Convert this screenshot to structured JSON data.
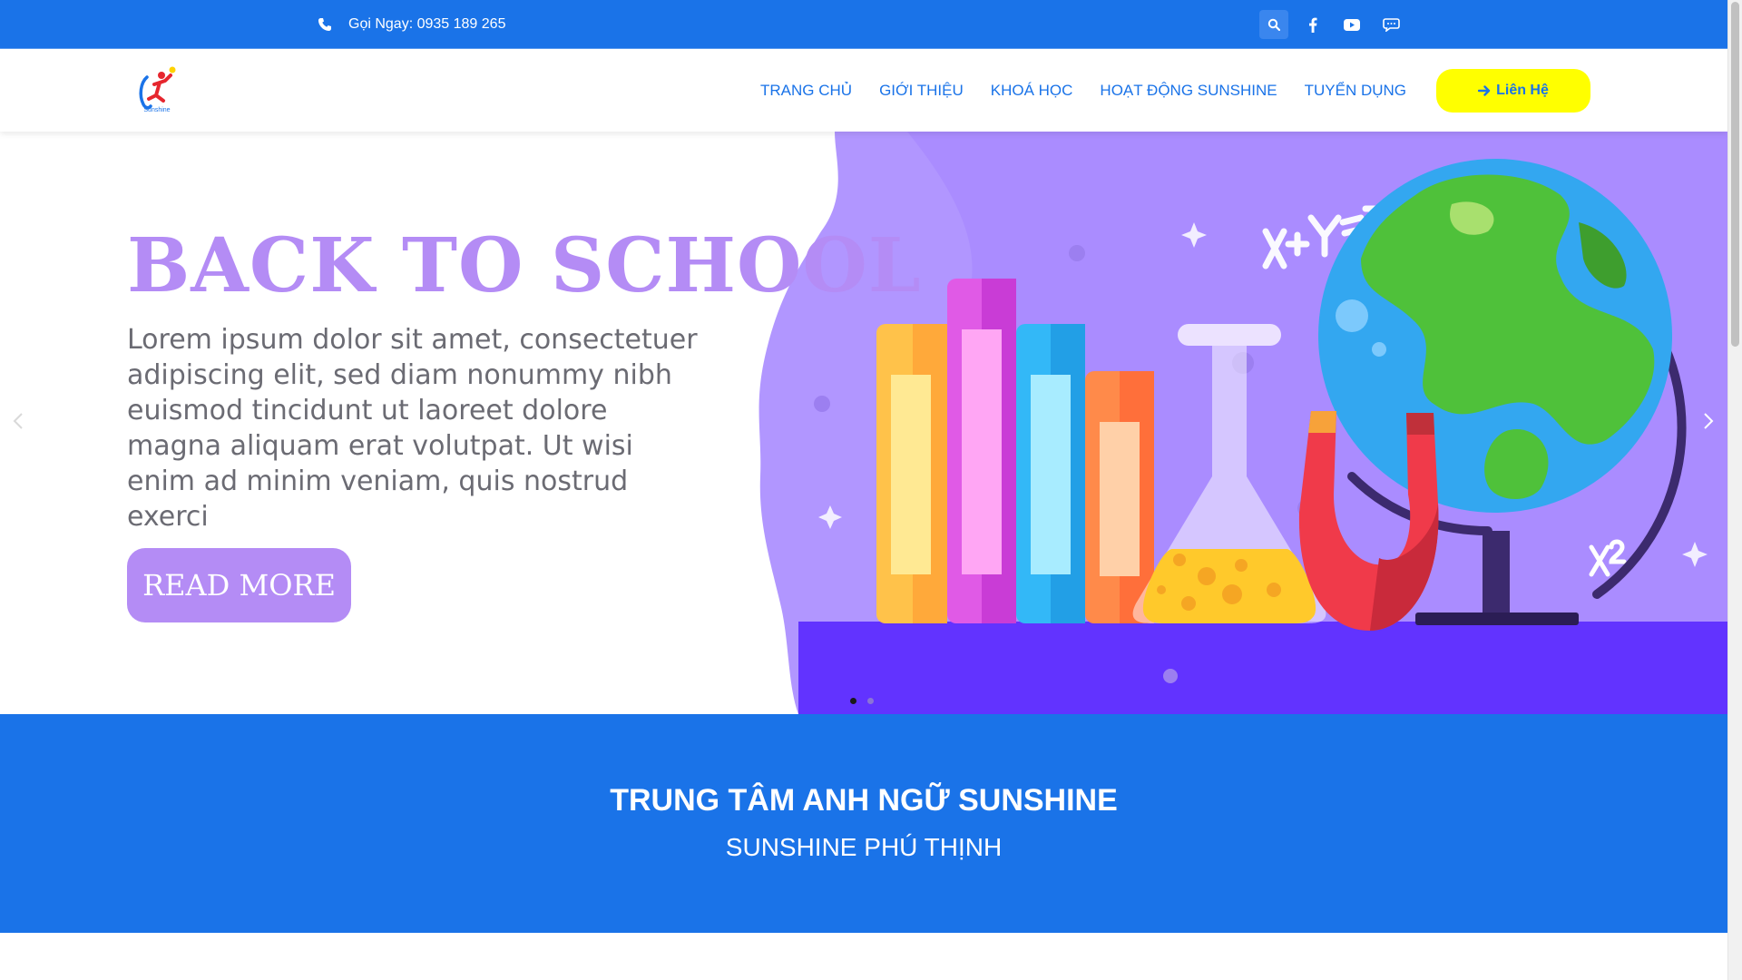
{
  "topbar": {
    "phone_text": "Gọi Ngay: 0935 189 265",
    "icons": [
      "search-icon",
      "facebook-icon",
      "youtube-icon",
      "chat-icon"
    ]
  },
  "header": {
    "logo_caption": "Sunshine",
    "nav": [
      "TRANG CHỦ",
      "GIỚI THIỆU",
      "KHOÁ HỌC",
      "HOẠT ĐỘNG SUNSHINE",
      "TUYỂN DỤNG"
    ],
    "cta_label": "Liên Hệ"
  },
  "hero": {
    "title": "BACK TO SCHOOL",
    "text": "Lorem ipsum dolor sit amet, consectetuer adipiscing elit, sed diam nonummy nibh euismod tincidunt ut laoreet dolore magna aliquam erat volutpat. Ut wisi enim ad minim veniam, quis nostrud exerci",
    "button": "READ MORE",
    "formula_1": "X+Y=Z",
    "formula_2": "X²",
    "slide_count": 2,
    "active_slide": 1
  },
  "band": {
    "title": "TRUNG TÂM ANH NGỮ SUNSHINE",
    "subtitle": "SUNSHINE PHÚ THỊNH"
  },
  "colors": {
    "primary": "#1a73e8",
    "cta": "#ffff00",
    "hero_purple": "#b48cf5",
    "hero_floor": "#6233ff"
  }
}
